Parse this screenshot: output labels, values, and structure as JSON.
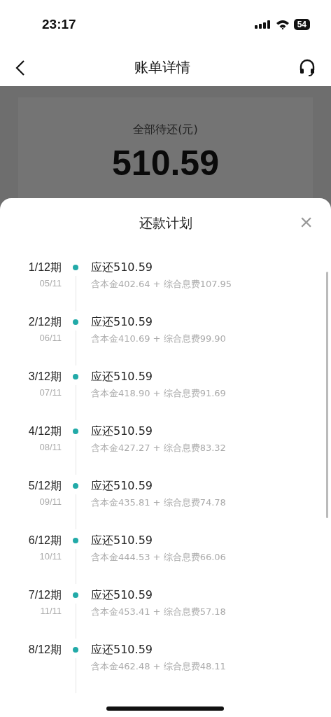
{
  "status_bar": {
    "time": "23:17",
    "battery": "54"
  },
  "nav": {
    "title": "账单详情"
  },
  "summary": {
    "label": "全部待还(元)",
    "amount": "510.59"
  },
  "sheet": {
    "title": "还款计划",
    "close": "×",
    "rows": [
      {
        "period": "1/12期",
        "date": "05/11",
        "amount": "应还510.59",
        "detail": "含本金402.64 + 综合息费107.95"
      },
      {
        "period": "2/12期",
        "date": "06/11",
        "amount": "应还510.59",
        "detail": "含本金410.69 + 综合息费99.90"
      },
      {
        "period": "3/12期",
        "date": "07/11",
        "amount": "应还510.59",
        "detail": "含本金418.90 + 综合息费91.69"
      },
      {
        "period": "4/12期",
        "date": "08/11",
        "amount": "应还510.59",
        "detail": "含本金427.27 + 综合息费83.32"
      },
      {
        "period": "5/12期",
        "date": "09/11",
        "amount": "应还510.59",
        "detail": "含本金435.81 + 综合息费74.78"
      },
      {
        "period": "6/12期",
        "date": "10/11",
        "amount": "应还510.59",
        "detail": "含本金444.53 + 综合息费66.06"
      },
      {
        "period": "7/12期",
        "date": "11/11",
        "amount": "应还510.59",
        "detail": "含本金453.41 + 综合息费57.18"
      },
      {
        "period": "8/12期",
        "amount": "应还510.59",
        "detail": "含本金462.48 + 综合息费48.11"
      }
    ]
  }
}
